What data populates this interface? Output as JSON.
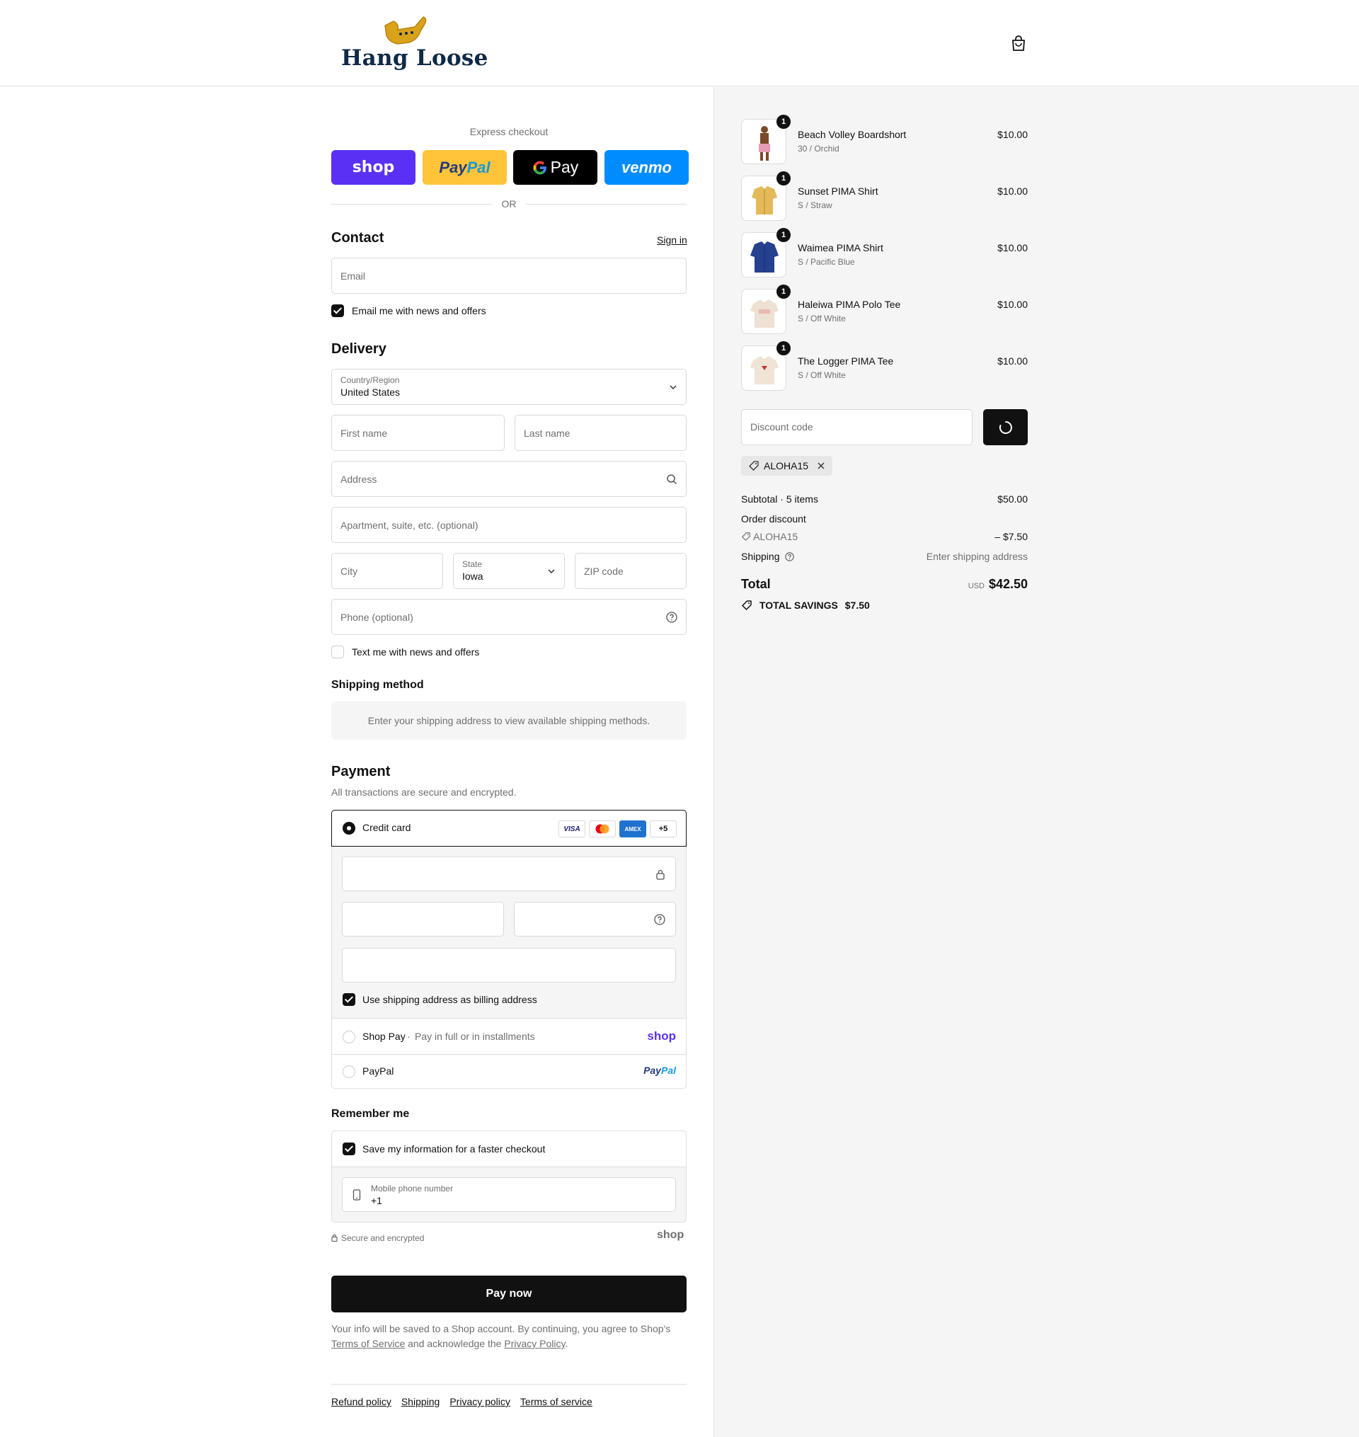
{
  "header": {
    "brand": "Hang Loose",
    "cart_icon": "shopping-bag-icon"
  },
  "express": {
    "label": "Express checkout",
    "buttons": {
      "shop": "shop",
      "paypal_a": "Pay",
      "paypal_b": "Pal",
      "gpay": "Pay",
      "venmo": "venmo"
    },
    "or": "OR"
  },
  "contact": {
    "title": "Contact",
    "sign_in": "Sign in",
    "email_placeholder": "Email",
    "news_label": "Email me with news and offers",
    "news_checked": true
  },
  "delivery": {
    "title": "Delivery",
    "country_label": "Country/Region",
    "country_value": "United States",
    "first_name": "First name",
    "last_name": "Last name",
    "address": "Address",
    "apartment": "Apartment, suite, etc. (optional)",
    "city": "City",
    "state_label": "State",
    "state_value": "Iowa",
    "zip": "ZIP code",
    "phone": "Phone (optional)",
    "text_label": "Text me with news and offers",
    "text_checked": false
  },
  "shipping_method": {
    "title": "Shipping method",
    "info": "Enter your shipping address to view available shipping methods."
  },
  "payment": {
    "title": "Payment",
    "subtitle": "All transactions are secure and encrypted.",
    "credit_card": "Credit card",
    "cards": [
      "VISA",
      "MC",
      "AMEX",
      "+5"
    ],
    "billing_label": "Use shipping address as billing address",
    "shop_pay": "Shop Pay",
    "shop_pay_sub": "Pay in full or in installments",
    "shop_pay_logo": "shop",
    "paypal": "PayPal",
    "paypal_logo_a": "Pay",
    "paypal_logo_b": "Pal"
  },
  "remember": {
    "title": "Remember me",
    "save_label": "Save my information for a faster checkout",
    "mobile_label": "Mobile phone number",
    "mobile_value": "+1",
    "secure": "Secure and encrypted",
    "shop_logo": "shop"
  },
  "pay_now": "Pay now",
  "legal": {
    "line1": "Your info will be saved to a Shop account. By continuing, you agree to Shop's",
    "tos": "Terms of Service",
    "mid": "and acknowledge the",
    "privacy": "Privacy Policy",
    "end": "."
  },
  "footer": [
    "Refund policy",
    "Shipping",
    "Privacy policy",
    "Terms of service"
  ],
  "order": {
    "items": [
      {
        "name": "Beach Volley Boardshort",
        "variant": "30 / Orchid",
        "price": "$10.00",
        "qty": "1",
        "color": "#e89bb4"
      },
      {
        "name": "Sunset PIMA Shirt",
        "variant": "S / Straw",
        "price": "$10.00",
        "qty": "1",
        "color": "#e4b95a"
      },
      {
        "name": "Waimea PIMA Shirt",
        "variant": "S / Pacific Blue",
        "price": "$10.00",
        "qty": "1",
        "color": "#24408e"
      },
      {
        "name": "Haleiwa PIMA Polo Tee",
        "variant": "S / Off White",
        "price": "$10.00",
        "qty": "1",
        "color": "#eee0d2"
      },
      {
        "name": "The Logger PIMA Tee",
        "variant": "S / Off White",
        "price": "$10.00",
        "qty": "1",
        "color": "#efe4d6"
      }
    ],
    "discount_placeholder": "Discount code",
    "tag": "ALOHA15",
    "subtotal_label": "Subtotal",
    "subtotal_items": "5 items",
    "subtotal": "$50.00",
    "order_discount": "Order discount",
    "discount_code": "ALOHA15",
    "discount_amount": "– $7.50",
    "shipping_label": "Shipping",
    "shipping_value": "Enter shipping address",
    "total_label": "Total",
    "currency": "USD",
    "total": "$42.50",
    "savings_label": "TOTAL SAVINGS",
    "savings": "$7.50"
  }
}
